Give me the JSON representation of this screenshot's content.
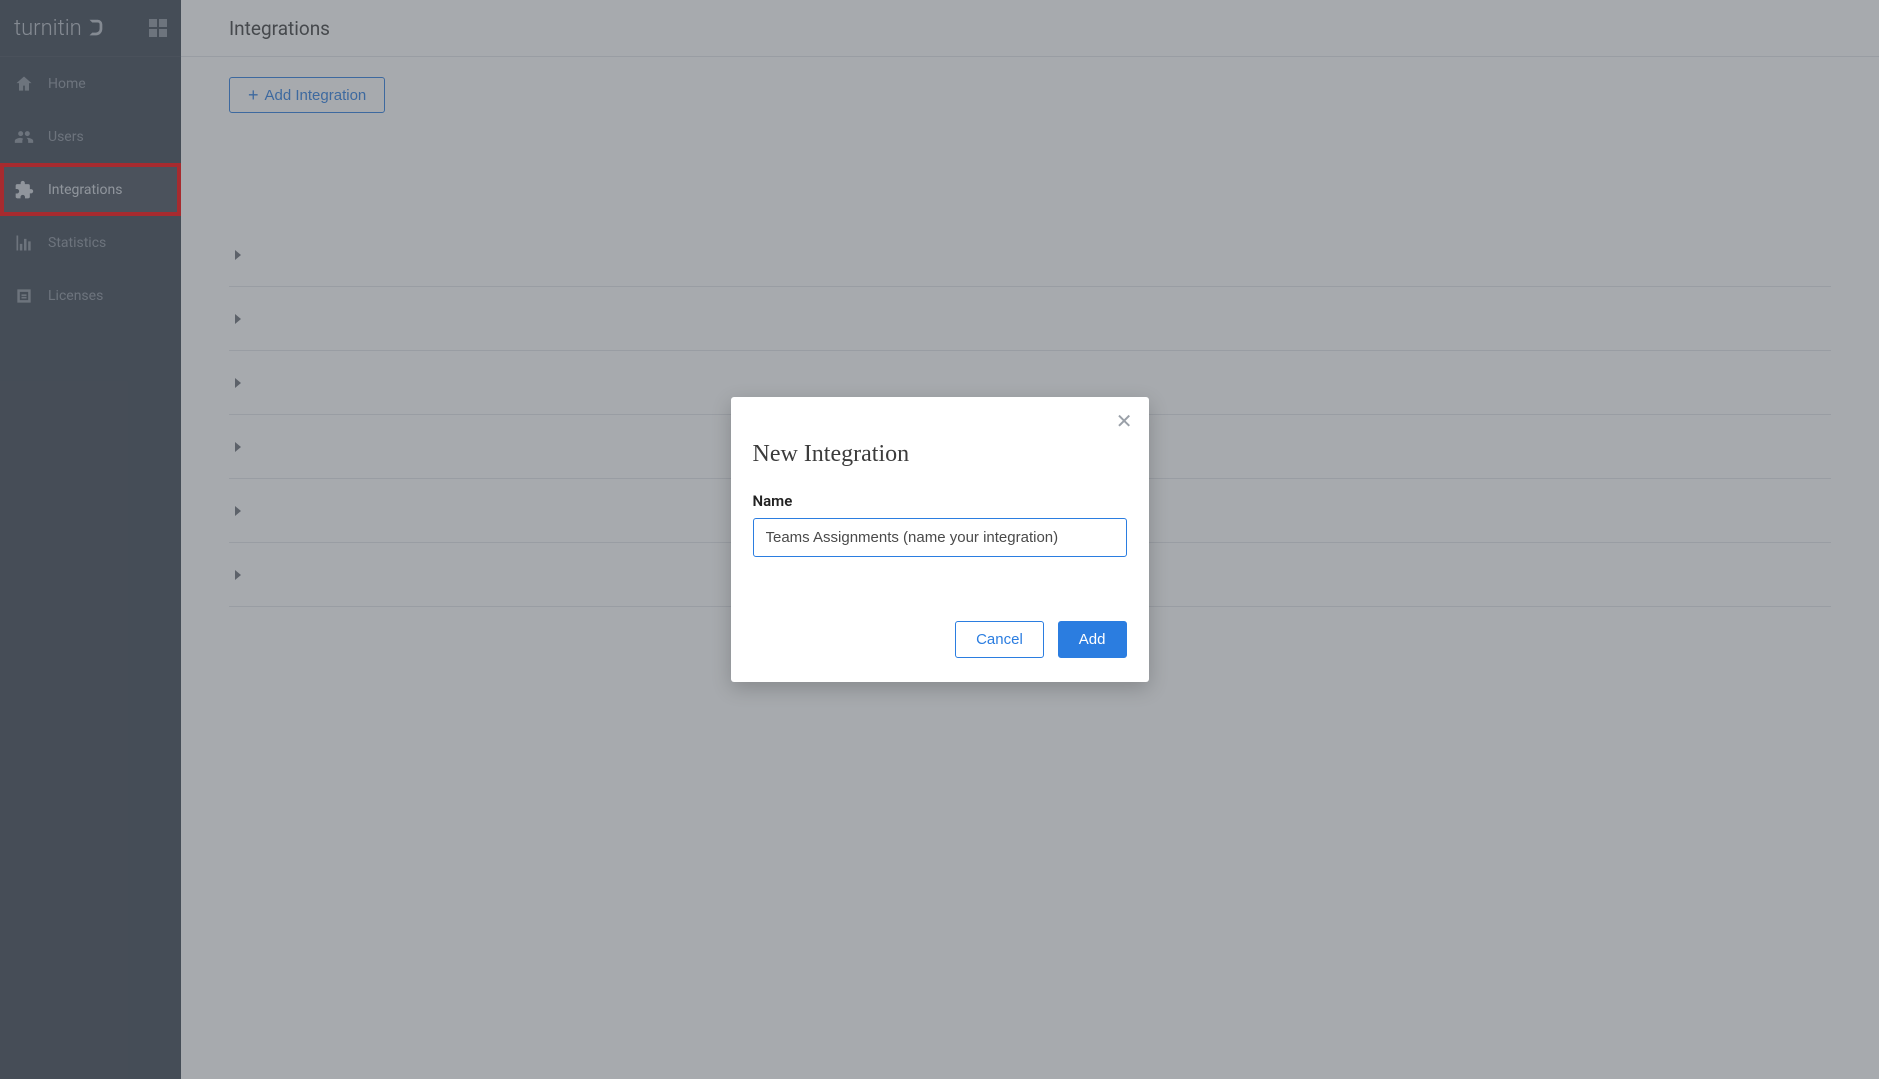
{
  "brand": {
    "name": "turnitin"
  },
  "sidebar": {
    "items": [
      {
        "label": "Home",
        "icon": "home-icon",
        "active": false
      },
      {
        "label": "Users",
        "icon": "users-icon",
        "active": false
      },
      {
        "label": "Integrations",
        "icon": "puzzle-icon",
        "active": true,
        "highlight": true
      },
      {
        "label": "Statistics",
        "icon": "chart-icon",
        "active": false
      },
      {
        "label": "Licenses",
        "icon": "license-icon",
        "active": false
      }
    ]
  },
  "page": {
    "title": "Integrations",
    "add_button_label": "Add Integration",
    "row_count": 6
  },
  "modal": {
    "title": "New Integration",
    "name_label": "Name",
    "name_value": "Teams Assignments (name your integration)",
    "cancel_label": "Cancel",
    "add_label": "Add"
  }
}
